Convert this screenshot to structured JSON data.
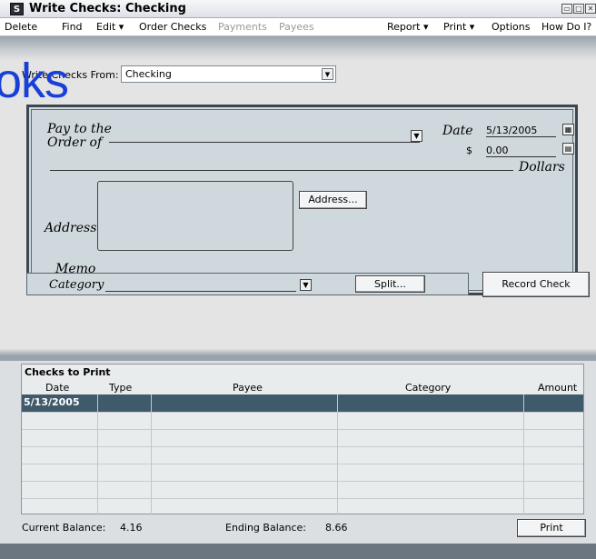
{
  "window": {
    "icon_letter": "S",
    "title": "Write Checks: Checking",
    "controls": [
      "▭",
      "□",
      "✕"
    ]
  },
  "menubar": {
    "items": [
      {
        "label": "Delete",
        "disabled": false
      },
      {
        "label": "Find",
        "disabled": false
      },
      {
        "label": "Edit ▾",
        "disabled": false
      },
      {
        "label": "Order Checks",
        "disabled": false
      },
      {
        "label": "Payments",
        "disabled": true
      },
      {
        "label": "Payees",
        "disabled": true
      },
      {
        "label": "Report ▾",
        "disabled": false
      },
      {
        "label": "Print ▾",
        "disabled": false
      },
      {
        "label": "Options",
        "disabled": false
      },
      {
        "label": "How Do I?",
        "disabled": false
      }
    ]
  },
  "overlay_text": "oks",
  "from": {
    "label": "Write Checks From:",
    "value": "Checking"
  },
  "check": {
    "pay_to_label_1": "Pay to the",
    "pay_to_label_2": "Order of",
    "payee_value": "",
    "date_label": "Date",
    "date_value": "5/13/2005",
    "dollar_sign": "$",
    "amount_value": "0.00",
    "dollars_label": "Dollars",
    "address_label": "Address",
    "address_button": "Address...",
    "memo_label": "Memo"
  },
  "category": {
    "label": "Category",
    "split_button": "Split...",
    "record_button": "Record Check"
  },
  "checks_to_print": {
    "title": "Checks to Print",
    "columns": [
      "Date",
      "Type",
      "Payee",
      "Category",
      "Amount"
    ],
    "rows": [
      {
        "date": "5/13/2005",
        "type": "",
        "payee": "",
        "category": "",
        "amount": ""
      }
    ],
    "current_balance_label": "Current Balance:",
    "current_balance": "4.16",
    "ending_balance_label": "Ending Balance:",
    "ending_balance": "8.66",
    "print_button": "Print"
  }
}
